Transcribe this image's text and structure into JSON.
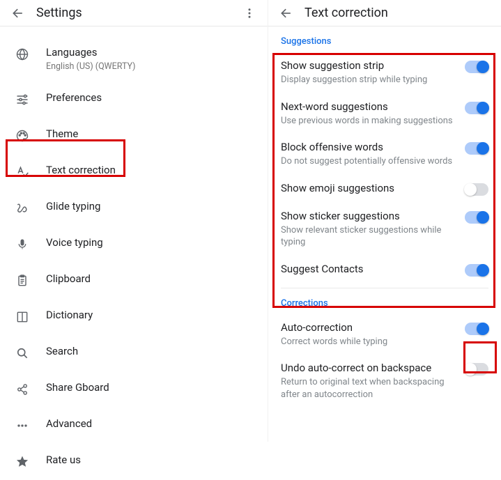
{
  "left": {
    "title": "Settings",
    "items": [
      {
        "id": "languages",
        "label": "Languages",
        "sublabel": "English (US) (QWERTY)",
        "icon": "globe-icon"
      },
      {
        "id": "preferences",
        "label": "Preferences",
        "icon": "tune-icon"
      },
      {
        "id": "theme",
        "label": "Theme",
        "icon": "palette-icon"
      },
      {
        "id": "text-correction",
        "label": "Text correction",
        "icon": "spellcheck-icon",
        "highlighted": true
      },
      {
        "id": "glide-typing",
        "label": "Glide typing",
        "icon": "gesture-icon"
      },
      {
        "id": "voice-typing",
        "label": "Voice typing",
        "icon": "mic-icon"
      },
      {
        "id": "clipboard",
        "label": "Clipboard",
        "icon": "clipboard-icon"
      },
      {
        "id": "dictionary",
        "label": "Dictionary",
        "icon": "book-icon"
      },
      {
        "id": "search",
        "label": "Search",
        "icon": "search-icon"
      },
      {
        "id": "share",
        "label": "Share Gboard",
        "icon": "share-icon"
      },
      {
        "id": "advanced",
        "label": "Advanced",
        "icon": "more-icon"
      },
      {
        "id": "rate-us",
        "label": "Rate us",
        "icon": "star-icon"
      }
    ]
  },
  "right": {
    "title": "Text correction",
    "sections": [
      {
        "header": "Suggestions",
        "highlighted": true,
        "rows": [
          {
            "primary": "Show suggestion strip",
            "secondary": "Display suggestion strip while typing",
            "on": true
          },
          {
            "primary": "Next-word suggestions",
            "secondary": "Use previous words in making suggestions",
            "on": true
          },
          {
            "primary": "Block offensive words",
            "secondary": "Do not suggest potentially offensive words",
            "on": true
          },
          {
            "primary": "Show emoji suggestions",
            "secondary": "",
            "on": false
          },
          {
            "primary": "Show sticker suggestions",
            "secondary": "Show relevant sticker suggestions while typing",
            "on": true
          },
          {
            "primary": "Suggest Contacts",
            "secondary": "",
            "on": true
          }
        ]
      },
      {
        "header": "Corrections",
        "rows": [
          {
            "primary": "Auto-correction",
            "secondary": "Correct words while typing",
            "on": true,
            "toggle_highlighted": true
          },
          {
            "primary": "Undo auto-correct on backspace",
            "secondary": "Return to original text when backspacing after an autocorrection",
            "on": false
          }
        ]
      }
    ]
  },
  "highlight_color": "#d70000"
}
